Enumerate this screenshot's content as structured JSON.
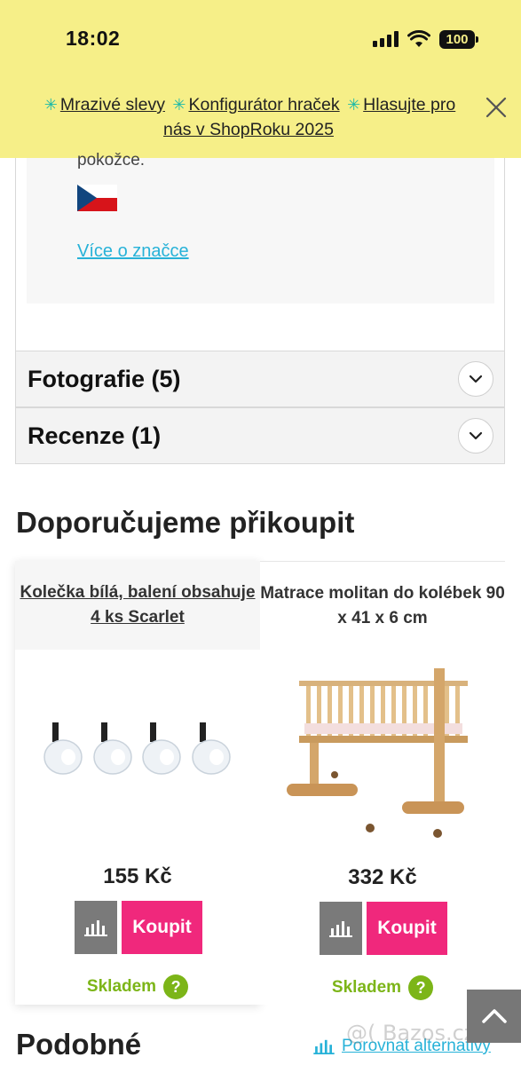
{
  "status_bar": {
    "time": "18:02",
    "battery": "100"
  },
  "banner": {
    "link1": "Mrazivé slevy",
    "link2": "Konfigurátor hraček",
    "link3": "Hlasujte pro nás v ShopRoku 2025",
    "close_icon": "close-icon"
  },
  "brand": {
    "text_fragment": "pokožce.",
    "link": "Více o značce"
  },
  "accordions": [
    {
      "label": "Fotografie (5)"
    },
    {
      "label": "Recenze (1)"
    }
  ],
  "section_title": "Doporučujeme přikoupit",
  "products": [
    {
      "title": "Kolečka bílá, balení obsahuje 4 ks Scarlet",
      "price": "155 Kč",
      "buy_label": "Koupit",
      "stock": "Skladem",
      "help": "?"
    },
    {
      "title": "Matrace molitan do kolébek 90 x 41 x 6 cm",
      "price": "332 Kč",
      "buy_label": "Koupit",
      "stock": "Skladem",
      "help": "?"
    }
  ],
  "bottom": {
    "title": "Podobné",
    "compare_link": "Porovnat alternativy",
    "watermark": "@( Bazos.cz"
  },
  "colors": {
    "banner_bg": "#f6ef88",
    "accent_pink": "#f0287c",
    "link_blue": "#27b2d8",
    "stock_green": "#7cb518"
  }
}
